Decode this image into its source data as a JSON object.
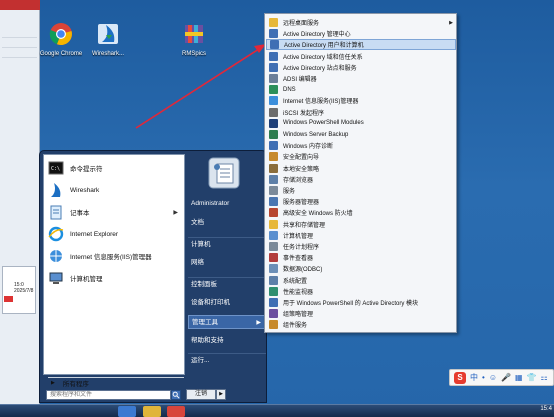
{
  "desktop": {
    "icons": [
      {
        "label": "Google Chrome"
      },
      {
        "label": "Wireshark..."
      },
      {
        "label": "RMSpics"
      }
    ]
  },
  "left_strip": {
    "thumb_text": "15:0\n2025/7/8"
  },
  "start_menu": {
    "pinned": [
      {
        "label": "命令提示符",
        "icon": "cmd-icon"
      },
      {
        "label": "Wireshark",
        "icon": "wireshark-icon"
      },
      {
        "label": "记事本",
        "icon": "notepad-icon",
        "has_submenu": true
      },
      {
        "label": "Internet Explorer",
        "icon": "ie-icon"
      },
      {
        "label": "Internet 信息服务(IIS)管理器",
        "icon": "iis-icon"
      },
      {
        "label": "计算机管理",
        "icon": "computer-management-icon"
      }
    ],
    "all_programs": "所有程序",
    "search_placeholder": "搜索程序和文件",
    "right_items": [
      {
        "label": "Administrator"
      },
      {
        "label": "文档"
      },
      {
        "label": "计算机"
      },
      {
        "label": "网络"
      },
      {
        "label": "控制面板"
      },
      {
        "label": "设备和打印机"
      },
      {
        "label": "管理工具",
        "has_submenu": true,
        "active": true
      },
      {
        "label": "帮助和支持"
      },
      {
        "label": "运行..."
      }
    ],
    "shutdown_label": "注销",
    "shutdown_arrow": "▶"
  },
  "admin_tools_submenu": [
    {
      "label": "远程桌面服务",
      "has_submenu": true,
      "icon": "folder-icon"
    },
    {
      "label": "Active Directory 管理中心",
      "icon": "ad-icon"
    },
    {
      "label": "Active Directory 用户和计算机",
      "icon": "ad-icon",
      "active": true
    },
    {
      "label": "Active Directory 域和信任关系",
      "icon": "ad-icon"
    },
    {
      "label": "Active Directory 站点和服务",
      "icon": "ad-icon"
    },
    {
      "label": "ADSI 编辑器",
      "icon": "adsi-icon"
    },
    {
      "label": "DNS",
      "icon": "dns-icon"
    },
    {
      "label": "Internet 信息服务(IIS)管理器",
      "icon": "iis-icon"
    },
    {
      "label": "iSCSI 发起程序",
      "icon": "iscsi-icon"
    },
    {
      "label": "Windows PowerShell Modules",
      "icon": "powershell-icon"
    },
    {
      "label": "Windows Server Backup",
      "icon": "backup-icon"
    },
    {
      "label": "Windows 内存诊断",
      "icon": "memory-icon"
    },
    {
      "label": "安全配置向导",
      "icon": "security-icon"
    },
    {
      "label": "本地安全策略",
      "icon": "policy-icon"
    },
    {
      "label": "存储浏览器",
      "icon": "storage-icon"
    },
    {
      "label": "服务",
      "icon": "services-icon"
    },
    {
      "label": "服务器管理器",
      "icon": "server-icon"
    },
    {
      "label": "高级安全 Windows 防火墙",
      "icon": "firewall-icon"
    },
    {
      "label": "共享和存储管理",
      "icon": "share-icon"
    },
    {
      "label": "计算机管理",
      "icon": "computer-icon"
    },
    {
      "label": "任务计划程序",
      "icon": "task-icon"
    },
    {
      "label": "事件查看器",
      "icon": "event-icon"
    },
    {
      "label": "数据源(ODBC)",
      "icon": "odbc-icon"
    },
    {
      "label": "系统配置",
      "icon": "config-icon"
    },
    {
      "label": "性能监视器",
      "icon": "perf-icon"
    },
    {
      "label": "用于 Windows PowerShell 的 Active Directory 模块",
      "icon": "ad-ps-icon"
    },
    {
      "label": "组策略管理",
      "icon": "gpo-icon"
    },
    {
      "label": "组件服务",
      "icon": "component-icon"
    }
  ],
  "tray": {
    "logo": "S",
    "items": [
      "中",
      "•",
      "☺",
      "🎤",
      "▦",
      "👕",
      "⚏"
    ]
  },
  "clock": "15:4",
  "colors": {
    "accent": "#3a66a6",
    "submenu_highlight": "#c8dcf3",
    "arrow": "#e0283a"
  }
}
